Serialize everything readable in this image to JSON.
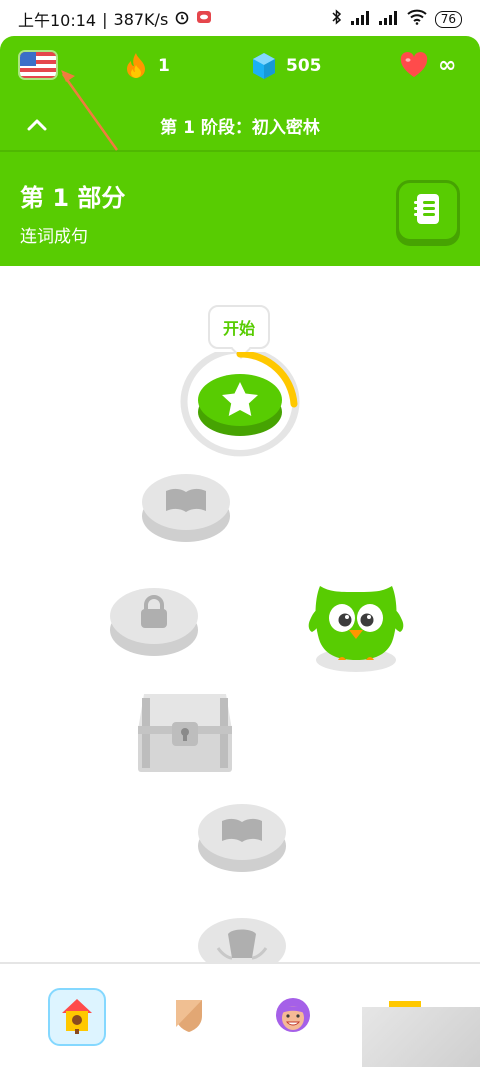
{
  "status_bar": {
    "time": "上午10:14",
    "network_speed": "387K/s",
    "battery": "76"
  },
  "header": {
    "streak_count": "1",
    "gems_count": "505",
    "hearts_count": "∞",
    "section_title": "第 1 阶段：初入密林",
    "unit_title": "第 1 部分",
    "unit_subtitle": "连词成句"
  },
  "path": {
    "start_label": "开始",
    "start_progress": 0.3
  },
  "colors": {
    "brand_green": "#58cc02",
    "dark_green": "#46a302",
    "locked_gray": "#e5e5e5",
    "progress_yellow": "#ffc800"
  },
  "icons": {
    "flag": "us-flag-icon",
    "streak": "flame-icon",
    "gems": "gem-icon",
    "hearts": "heart-icon",
    "guide": "guidebook-icon"
  }
}
